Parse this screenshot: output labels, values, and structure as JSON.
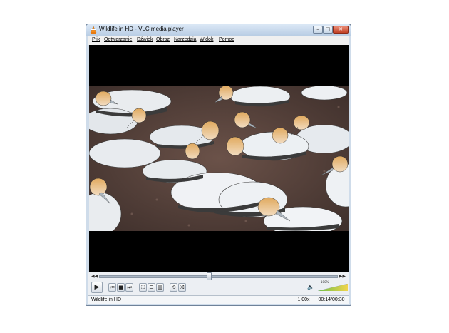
{
  "window": {
    "title": "Wildlife in HD - VLC media player",
    "controls": {
      "minimize": "–",
      "maximize": "□",
      "close": "✕"
    }
  },
  "menu": [
    {
      "label": "Plik"
    },
    {
      "label": "Odtwarzanie"
    },
    {
      "label": "Dźwięk"
    },
    {
      "label": "Obraz"
    },
    {
      "label": "Narzędzia"
    },
    {
      "label": "Widok"
    },
    {
      "label": "Pomoc"
    }
  ],
  "player": {
    "seek_position": 0.46,
    "volume_label": "100%",
    "volume_level": 1.0
  },
  "buttons": {
    "play": "▶",
    "prev": "⏮",
    "stop": "■",
    "next": "⏭",
    "fullscreen": "⛶",
    "playlist": "☰",
    "extended": "▥",
    "loop": "⟲",
    "random": "⤮"
  },
  "status": {
    "title": "Wildlife in HD",
    "speed": "1.00x",
    "time": "00:14/00:30"
  },
  "colors": {
    "title_bar_top": "#dbe8f6",
    "title_bar_bottom": "#b9cde4",
    "close_button": "#c24125",
    "video_background": "#000000",
    "volume_gradient_start": "#6cc04a",
    "volume_gradient_end": "#f1d44b"
  }
}
